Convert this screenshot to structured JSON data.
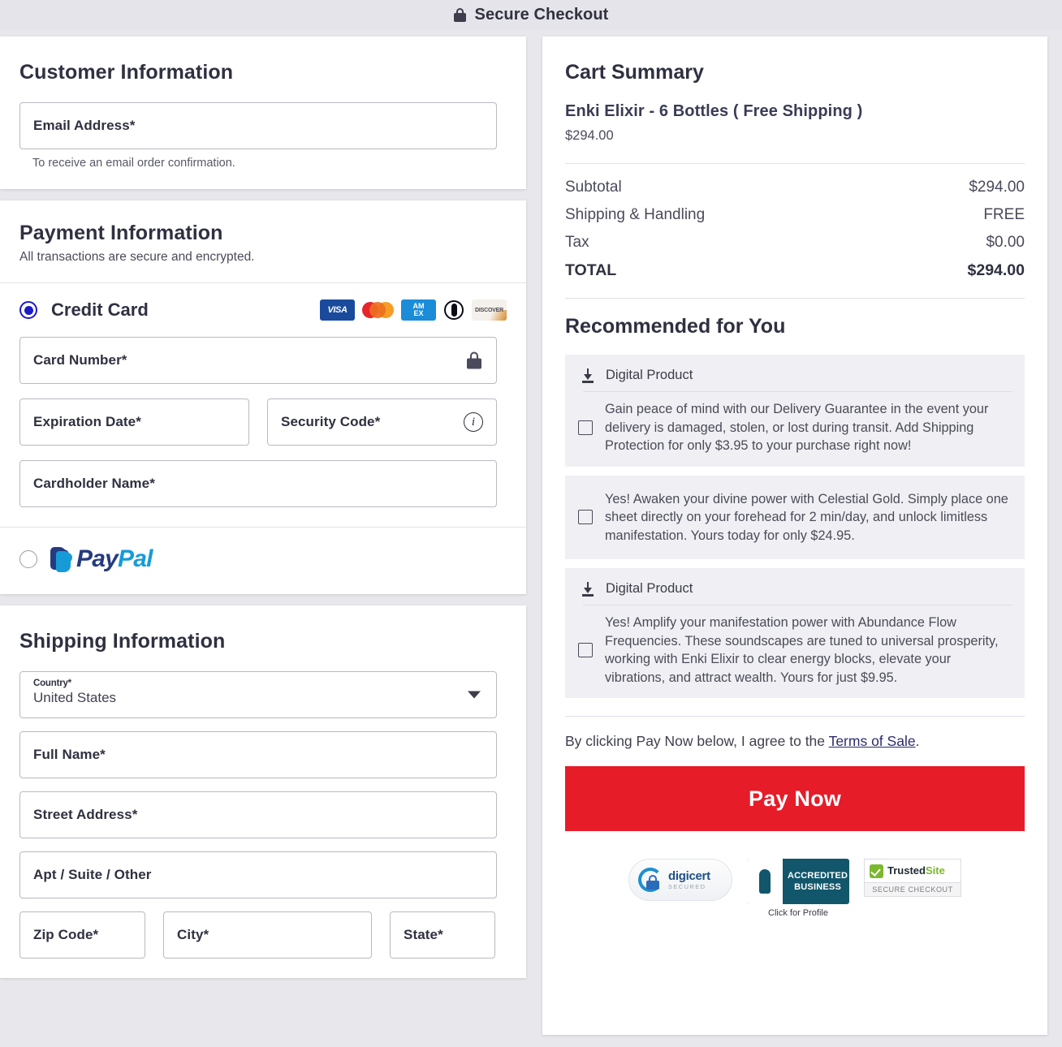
{
  "header": {
    "title": "Secure Checkout",
    "lock_icon": "lock-icon"
  },
  "customer": {
    "title": "Customer Information",
    "email_placeholder": "Email Address*",
    "helper": "To receive an email order confirmation."
  },
  "payment": {
    "title": "Payment Information",
    "subtitle": "All transactions are secure and encrypted.",
    "credit_card_label": "Credit Card",
    "card_brands": [
      "VISA",
      "Mastercard",
      "AMEX",
      "Diners Club",
      "Discover"
    ],
    "amex_line1": "AM",
    "amex_line2": "EX",
    "visa_text": "VISA",
    "discover_text": "DISCOVER",
    "card_number_placeholder": "Card Number*",
    "expiration_placeholder": "Expiration Date*",
    "security_placeholder": "Security Code*",
    "cardholder_placeholder": "Cardholder Name*",
    "info_glyph": "i",
    "paypal_label_a": "Pay",
    "paypal_label_b": "Pal"
  },
  "shipping": {
    "title": "Shipping Information",
    "country_label": "Country*",
    "country_value": "United States",
    "full_name_placeholder": "Full Name*",
    "street_placeholder": "Street Address*",
    "apt_placeholder": "Apt / Suite / Other",
    "zip_placeholder": "Zip Code*",
    "city_placeholder": "City*",
    "state_placeholder": "State*"
  },
  "cart": {
    "title": "Cart Summary",
    "item_name": "Enki Elixir - 6 Bottles ( Free Shipping )",
    "item_price": "$294.00",
    "rows": [
      {
        "label": "Subtotal",
        "value": "$294.00"
      },
      {
        "label": "Shipping & Handling",
        "value": "FREE"
      },
      {
        "label": "Tax",
        "value": "$0.00"
      }
    ],
    "total_label": "TOTAL",
    "total_value": "$294.00"
  },
  "recommended": {
    "title": "Recommended for You",
    "digital_product_label": "Digital Product",
    "offers": [
      {
        "has_header": true,
        "header": "Digital Product",
        "text": "Gain peace of mind with our Delivery Guarantee in the event your delivery is damaged, stolen, or lost during transit. Add Shipping Protection for only $3.95 to your purchase right now!",
        "checked": false
      },
      {
        "has_header": false,
        "header": "",
        "text": "Yes! Awaken your divine power with Celestial Gold. Simply place one sheet directly on your forehead for 2 min/day, and unlock limitless manifestation. Yours today for only $24.95.",
        "checked": false
      },
      {
        "has_header": true,
        "header": "Digital Product",
        "text": "Yes! Amplify your manifestation power with Abundance Flow Frequencies. These soundscapes are tuned to universal prosperity, working with Enki Elixir to clear energy blocks, elevate your vibrations, and attract wealth.  Yours for just $9.95.",
        "checked": false
      }
    ]
  },
  "footer": {
    "terms_prefix": "By clicking Pay Now below, I agree to the ",
    "terms_link": "Terms of Sale",
    "terms_suffix": ".",
    "pay_now_label": "Pay Now",
    "pay_now_color": "#e61c29",
    "badges": {
      "digicert_name": "digicert",
      "digicert_sub": "SECURED",
      "bbb_line1": "ACCREDITED",
      "bbb_line2": "BUSINESS",
      "bbb_click": "Click for Profile",
      "trusted_a": "Trusted",
      "trusted_b": "Site",
      "trusted_sub": "SECURE CHECKOUT"
    }
  }
}
